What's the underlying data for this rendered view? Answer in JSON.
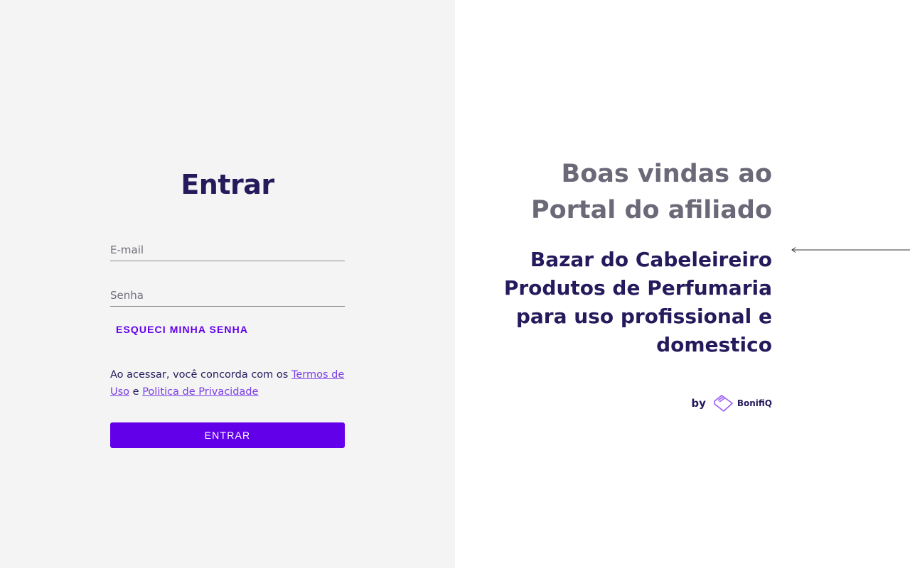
{
  "login": {
    "title": "Entrar",
    "email_placeholder": "E-mail",
    "password_placeholder": "Senha",
    "forgot_label": "ESQUECI MINHA SENHA",
    "terms_prefix": "Ao acessar, você concorda com os ",
    "terms_link": "Termos de Uso",
    "terms_joiner": " e ",
    "privacy_link": "Politica de Privacidade",
    "submit_label": "ENTRAR"
  },
  "hero": {
    "welcome_line1": "Boas vindas ao",
    "welcome_line2": "Portal do afiliado",
    "store_name": "Bazar do Cabeleireiro Produtos de Perfumaria para uso profissional e domestico",
    "by_label": "by",
    "brand_name": "BonifiQ"
  },
  "colors": {
    "primary": "#6200ea",
    "title": "#241a5c",
    "welcome": "#6b6878",
    "left_bg": "#f4f4f4",
    "link": "#7b3fe4"
  },
  "icons": {
    "brand_logo": "bonifiq-logo-icon",
    "arrow": "arrow-left-icon"
  }
}
